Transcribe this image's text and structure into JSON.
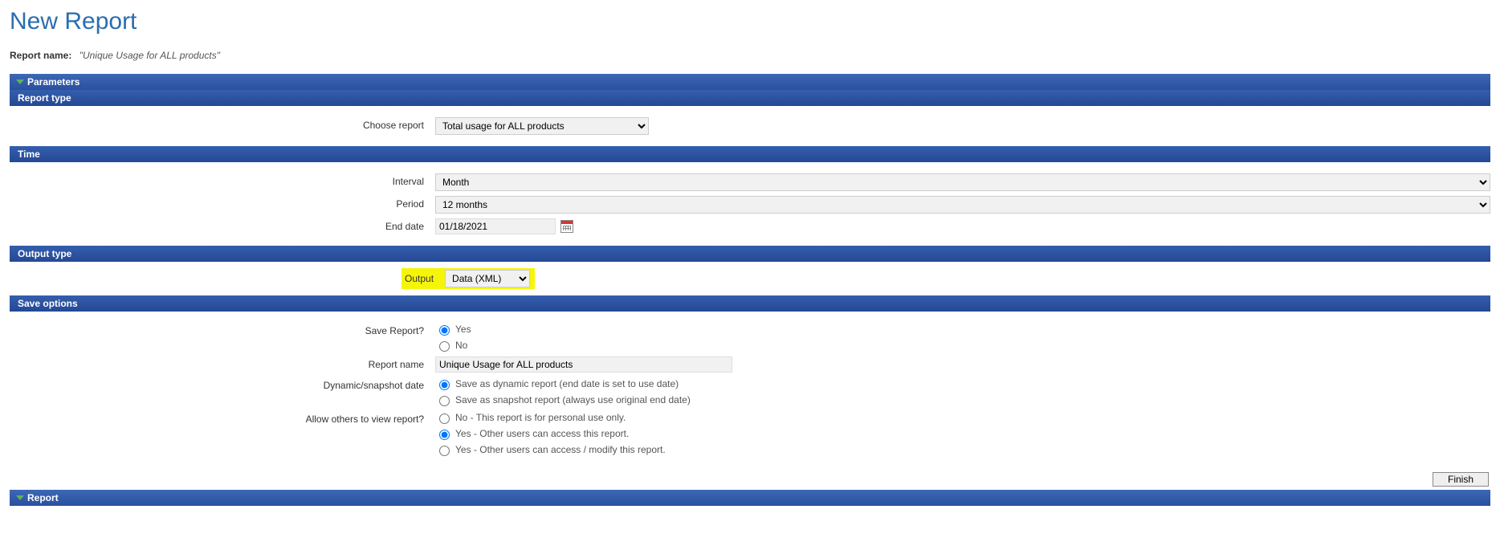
{
  "page": {
    "title": "New Report",
    "report_name_label": "Report name:",
    "report_name_value": "\"Unique Usage for ALL products\""
  },
  "sections": {
    "parameters": "Parameters",
    "report": "Report"
  },
  "subsections": {
    "report_type": "Report type",
    "time": "Time",
    "output_type": "Output type",
    "save_options": "Save options"
  },
  "report_type": {
    "label": "Choose report",
    "value": "Total usage for ALL products"
  },
  "time": {
    "interval_label": "Interval",
    "interval_value": "Month",
    "period_label": "Period",
    "period_value": "12 months",
    "end_date_label": "End date",
    "end_date_value": "01/18/2021"
  },
  "output": {
    "label": "Output",
    "value": "Data (XML)"
  },
  "save": {
    "save_report_label": "Save Report?",
    "yes": "Yes",
    "no": "No",
    "report_name_label": "Report name",
    "report_name_value": "Unique Usage for ALL products",
    "dynamic_label": "Dynamic/snapshot date",
    "dynamic_opt": "Save as dynamic report (end date is set to use date)",
    "snapshot_opt": "Save as snapshot report (always use original end date)",
    "allow_label": "Allow others to view report?",
    "allow_no": "No - This report is for personal use only.",
    "allow_yes_access": "Yes - Other users can access this report.",
    "allow_yes_modify": "Yes - Other users can access / modify this report."
  },
  "buttons": {
    "finish": "Finish"
  }
}
